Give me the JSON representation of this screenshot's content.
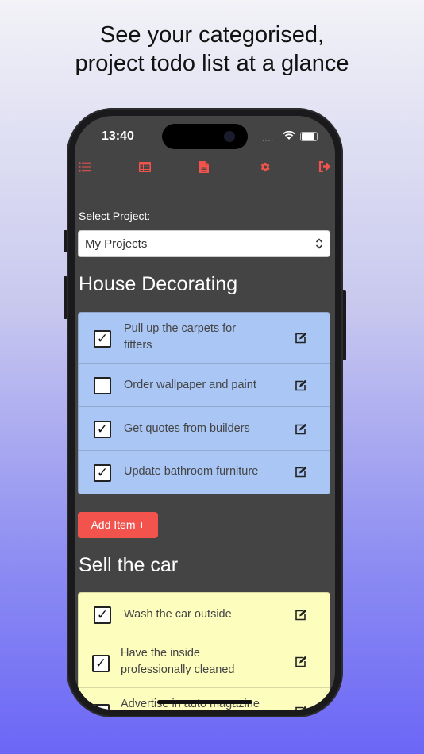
{
  "headline": {
    "line1": "See your categorised,",
    "line2": "project todo list at a glance"
  },
  "status_bar": {
    "time": "13:40",
    "signal": "....",
    "icons": [
      "wifi-icon",
      "battery-icon"
    ]
  },
  "nav": {
    "icons": [
      "list-icon",
      "table-icon",
      "file-icon",
      "gear-icon",
      "sign-out-icon"
    ],
    "color": "#f2534d"
  },
  "project_select": {
    "label": "Select Project:",
    "value": "My Projects"
  },
  "sections": [
    {
      "title": "House Decorating",
      "color": "#a9c6f4",
      "items": [
        {
          "text": "Pull up the carpets for fitters",
          "checked": true
        },
        {
          "text": "Order wallpaper and paint",
          "checked": false
        },
        {
          "text": "Get quotes from builders",
          "checked": true
        },
        {
          "text": "Update bathroom furniture",
          "checked": true
        }
      ]
    },
    {
      "title": "Sell the car",
      "color": "#fdfdbd",
      "items": [
        {
          "text": "Wash the car outside",
          "checked": true
        },
        {
          "text": "Have the inside professionally cleaned",
          "checked": true
        },
        {
          "text": "Advertise in auto magazine",
          "checked": false
        }
      ]
    }
  ],
  "add_item": {
    "label": "Add Item +"
  },
  "check_mark": "✓",
  "colors": {
    "screen_bg": "#444444",
    "accent": "#f2534d"
  }
}
